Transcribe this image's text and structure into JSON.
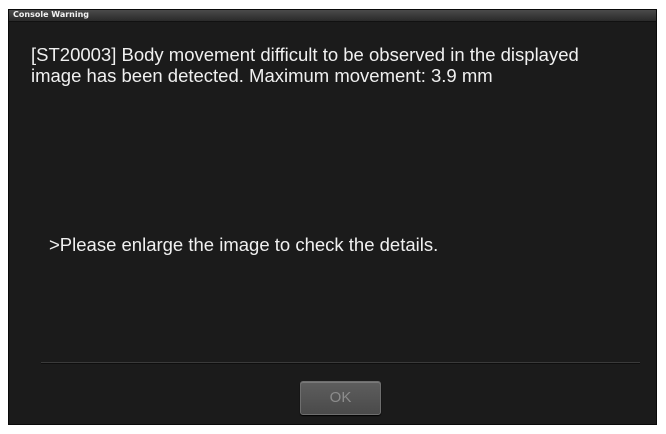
{
  "window": {
    "title": "Console Warning"
  },
  "message": {
    "text": "[ST20003] Body movement difficult to be observed in the displayed image has been detected. Maximum movement: 3.9 mm",
    "hint": ">Please enlarge the image to check the details."
  },
  "buttons": {
    "ok_label": "OK"
  }
}
